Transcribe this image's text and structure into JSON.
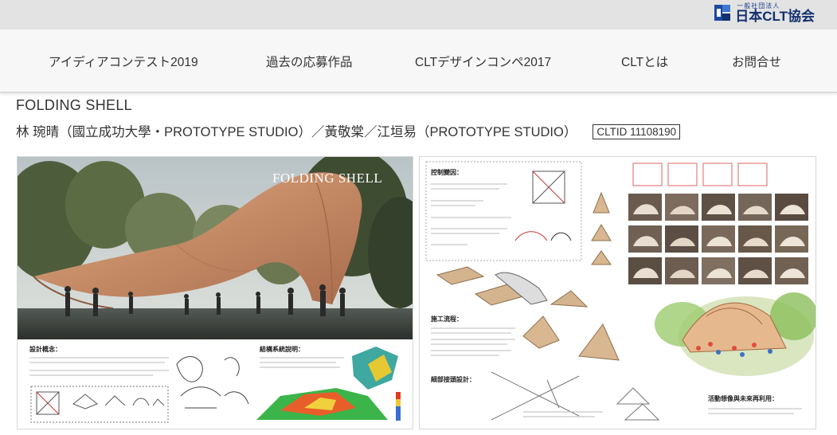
{
  "header": {
    "logo_small": "一般社団法人",
    "logo_main": "日本CLT協会"
  },
  "nav": {
    "items": [
      {
        "label": "アイディアコンテスト2019"
      },
      {
        "label": "過去の応募作品"
      },
      {
        "label": "CLTデザインコンペ2017"
      },
      {
        "label": "CLTとは"
      },
      {
        "label": "お問合せ"
      }
    ]
  },
  "entry": {
    "title": "FOLDING SHELL",
    "authors": "林 琬晴（國立成功大學・PROTOTYPE STUDIO）／黃敬棠／江垣易（PROTOTYPE STUDIO）",
    "clt_id": "CLTID 11108190"
  },
  "board1": {
    "render_title": "FOLDING SHELL",
    "section_design": "設計概念：",
    "section_structure": "結構系統說明："
  },
  "board2": {
    "section_control": "控制變因：",
    "section_process": "施工流程：",
    "section_detail": "細部接頭設計：",
    "section_future": "活動想像與未來再利用："
  },
  "colors": {
    "topbar": "#e3e3e3",
    "nav_bg": "#f7f7f7",
    "logo_blue": "#12306e",
    "shell_wood": "#c8906e"
  }
}
